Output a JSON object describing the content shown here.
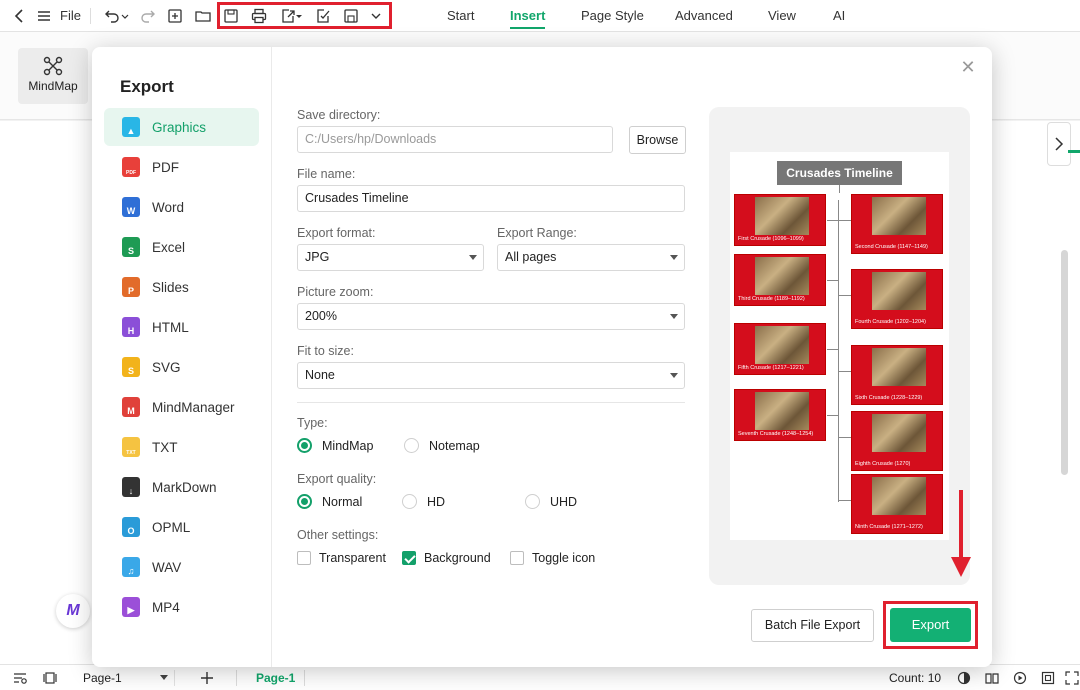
{
  "toolbar": {
    "file_label": "File",
    "tabs": [
      "Start",
      "Insert",
      "Page Style",
      "Advanced",
      "View",
      "AI"
    ],
    "active_tab": "Insert"
  },
  "ribbon": {
    "mindmap_label": "MindMap"
  },
  "dialog": {
    "title": "Export",
    "formats": [
      "Graphics",
      "PDF",
      "Word",
      "Excel",
      "Slides",
      "HTML",
      "SVG",
      "MindManager",
      "TXT",
      "MarkDown",
      "OPML",
      "WAV",
      "MP4"
    ],
    "format_colors": [
      "#29b6e6",
      "#e8403a",
      "#2f6fd6",
      "#1e9b54",
      "#e26b2a",
      "#8b4fd8",
      "#f2b31b",
      "#e0413a",
      "#f5c341",
      "#333333",
      "#2a9bd8",
      "#3aa8e8",
      "#9b4fd8"
    ],
    "format_glyphs": [
      "▲",
      "PDF",
      "W",
      "S",
      "P",
      "H",
      "S",
      "M",
      "TXT",
      "↓",
      "O",
      "♫",
      "▶"
    ],
    "save_directory_label": "Save directory:",
    "save_directory_value": "C:/Users/hp/Downloads",
    "browse_label": "Browse",
    "file_name_label": "File name:",
    "file_name_value": "Crusades Timeline",
    "export_format_label": "Export format:",
    "export_format_value": "JPG",
    "export_range_label": "Export Range:",
    "export_range_value": "All pages",
    "picture_zoom_label": "Picture zoom:",
    "picture_zoom_value": "200%",
    "fit_to_size_label": "Fit to size:",
    "fit_to_size_value": "None",
    "type_label": "Type:",
    "type_options": [
      "MindMap",
      "Notemap"
    ],
    "quality_label": "Export quality:",
    "quality_options": [
      "Normal",
      "HD",
      "UHD"
    ],
    "other_settings_label": "Other settings:",
    "other_options": [
      "Transparent",
      "Background",
      "Toggle icon"
    ],
    "batch_export_label": "Batch File Export",
    "export_label": "Export"
  },
  "preview": {
    "title": "Crusades Timeline",
    "left_cards": [
      "First Crusade (1096–1099)",
      "Third Crusade (1189–1192)",
      "Fifth Crusade (1217–1221)",
      "Seventh Crusade (1248–1254)"
    ],
    "right_cards": [
      "Second Crusade (1147–1149)",
      "Fourth Crusade (1202–1204)",
      "Sixth Crusade (1228–1229)",
      "Eighth Crusade (1270)",
      "Ninth Crusade (1271–1272)"
    ]
  },
  "statusbar": {
    "page_select": "Page-1",
    "page_tab": "Page-1",
    "count": "Count: 10"
  }
}
